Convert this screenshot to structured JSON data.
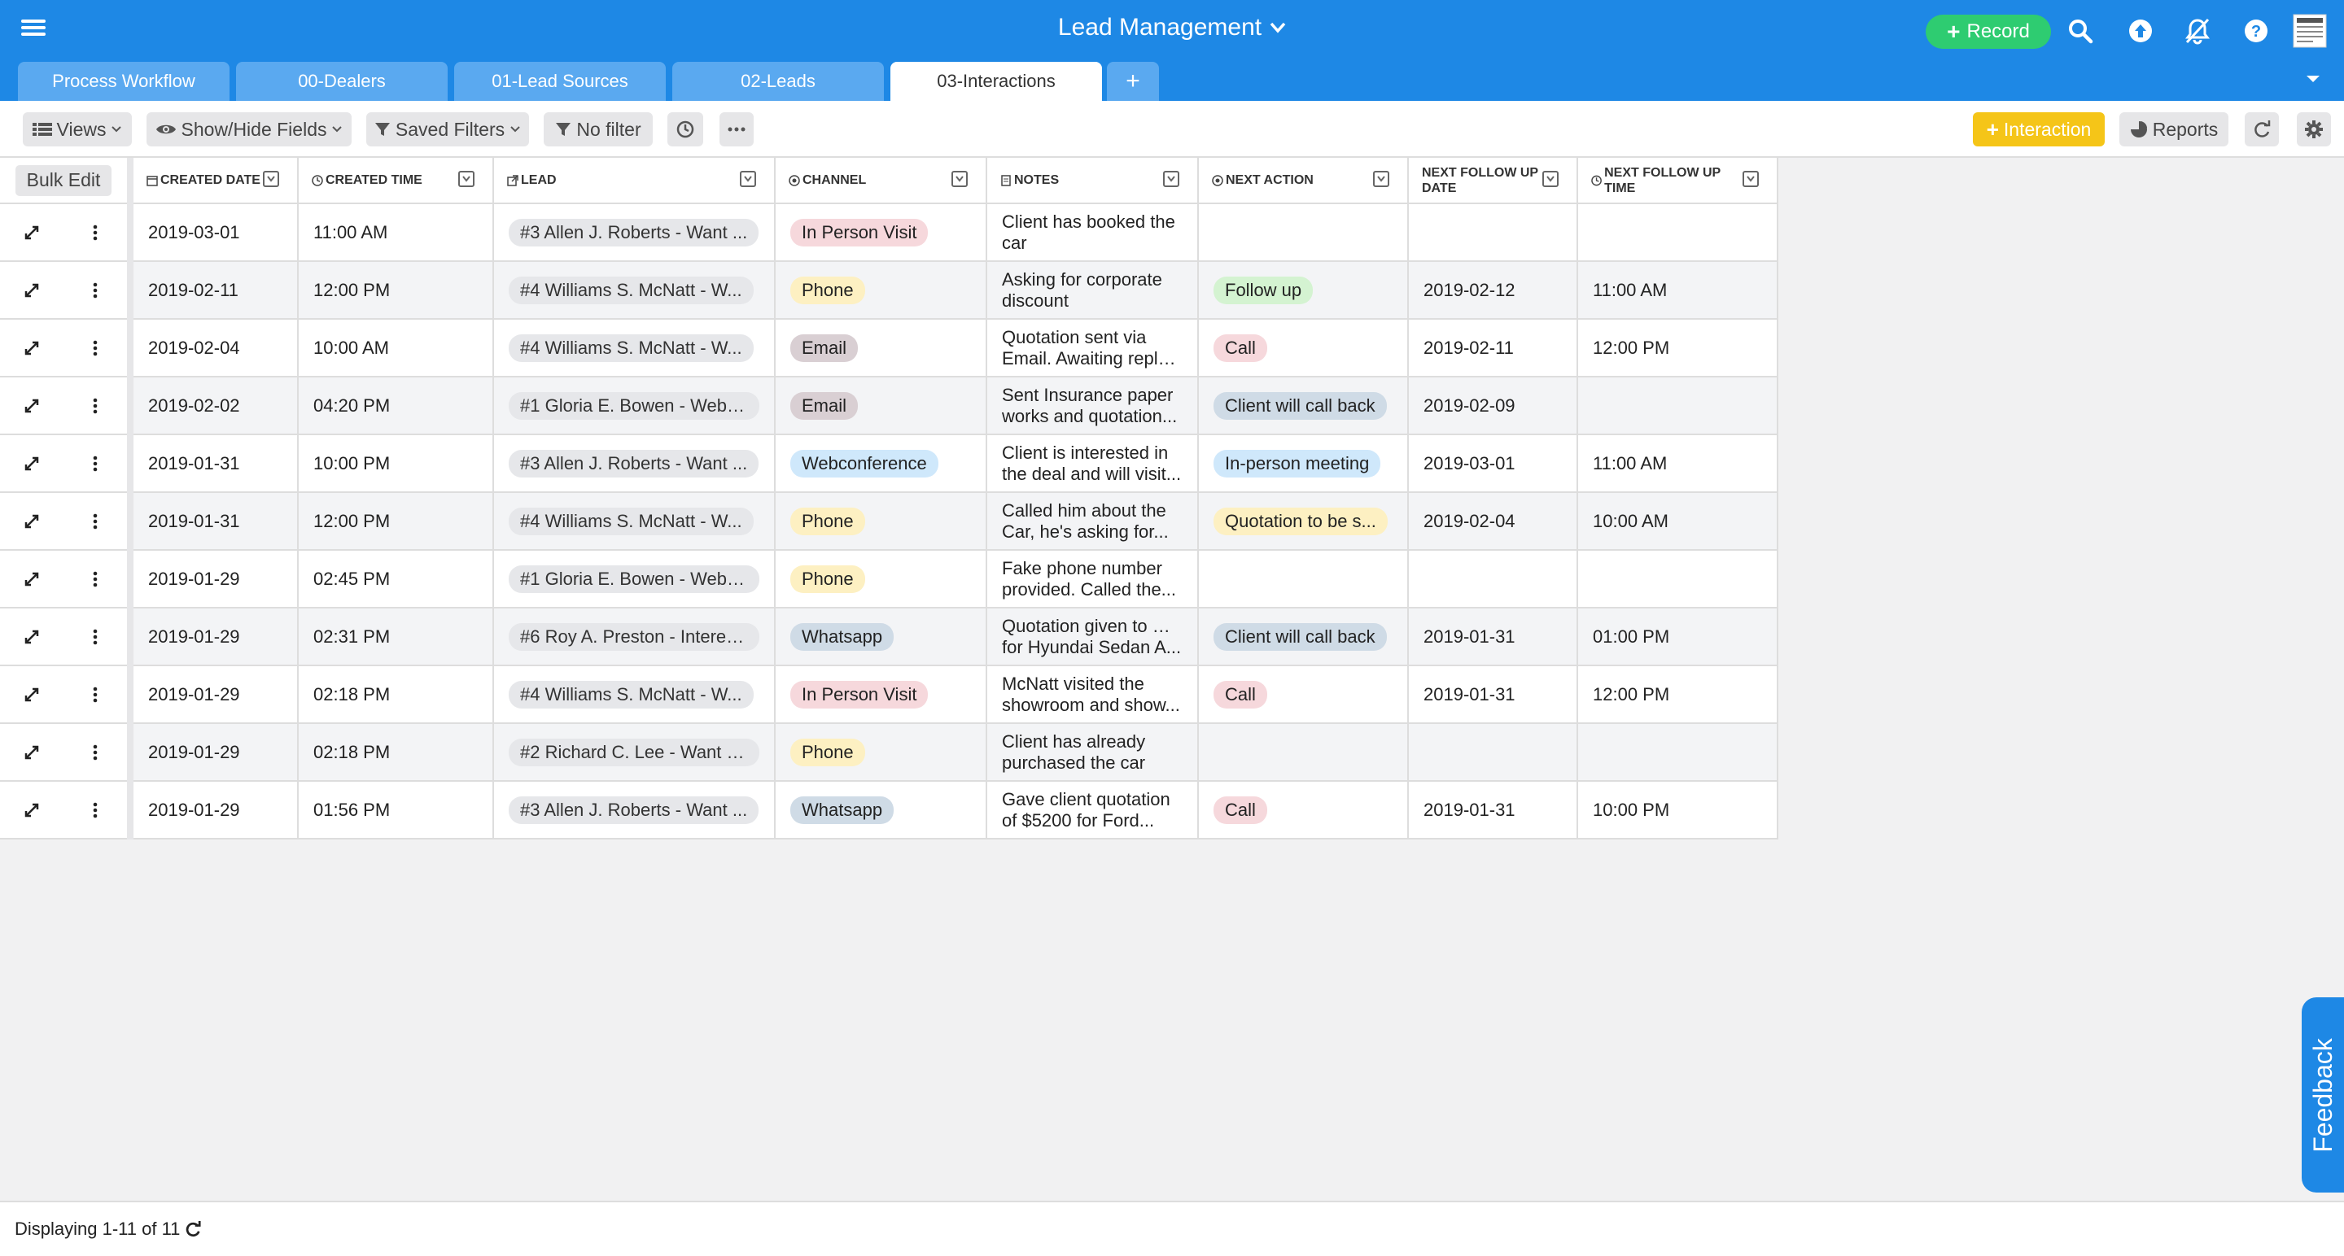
{
  "header": {
    "title": "Lead Management",
    "record_label": "Record"
  },
  "tabs": [
    {
      "label": "Process Workflow",
      "active": false
    },
    {
      "label": "00-Dealers",
      "active": false
    },
    {
      "label": "01-Lead Sources",
      "active": false
    },
    {
      "label": "02-Leads",
      "active": false
    },
    {
      "label": "03-Interactions",
      "active": true
    }
  ],
  "toolbar": {
    "views": "Views",
    "show_hide": "Show/Hide Fields",
    "saved_filters": "Saved Filters",
    "no_filter": "No filter",
    "interaction": "Interaction",
    "reports": "Reports"
  },
  "grid": {
    "bulk_edit": "Bulk Edit",
    "columns": [
      {
        "key": "created_date",
        "label": "CREATED DATE"
      },
      {
        "key": "created_time",
        "label": "CREATED TIME"
      },
      {
        "key": "lead",
        "label": "LEAD"
      },
      {
        "key": "channel",
        "label": "CHANNEL"
      },
      {
        "key": "notes",
        "label": "NOTES"
      },
      {
        "key": "next_action",
        "label": "NEXT ACTION"
      },
      {
        "key": "next_follow_up_date",
        "label": "NEXT FOLLOW UP DATE"
      },
      {
        "key": "next_follow_up_time",
        "label": "NEXT FOLLOW UP TIME"
      }
    ],
    "channel_colors": {
      "In Person Visit": "#f6d8dc",
      "Phone": "#fdf0c2",
      "Email": "#d9cfd3",
      "Webconference": "#cfe8fb",
      "Whatsapp": "#cfdbe6"
    },
    "action_colors": {
      "Follow up": "#d4f3d1",
      "Call": "#f6d8dc",
      "Client will call back": "#cfdbe6",
      "In-person meeting": "#cfe8fb",
      "Quotation to be s...": "#fdf0c2"
    },
    "rows": [
      {
        "created_date": "2019-03-01",
        "created_time": "11:00 AM",
        "lead": "#3 Allen J. Roberts - Want ...",
        "channel": "In Person Visit",
        "notes": [
          "Client has booked the",
          "car"
        ],
        "next_action": "",
        "next_follow_up_date": "",
        "next_follow_up_time": ""
      },
      {
        "created_date": "2019-02-11",
        "created_time": "12:00 PM",
        "lead": "#4 Williams S. McNatt - W...",
        "channel": "Phone",
        "notes": [
          "Asking for corporate",
          "discount"
        ],
        "next_action": "Follow up",
        "next_follow_up_date": "2019-02-12",
        "next_follow_up_time": "11:00 AM"
      },
      {
        "created_date": "2019-02-04",
        "created_time": "10:00 AM",
        "lead": "#4 Williams S. McNatt - W...",
        "channel": "Email",
        "notes": [
          "Quotation sent via",
          "Email. Awaiting reply...."
        ],
        "next_action": "Call",
        "next_follow_up_date": "2019-02-11",
        "next_follow_up_time": "12:00 PM"
      },
      {
        "created_date": "2019-02-02",
        "created_time": "04:20 PM",
        "lead": "#1 Gloria E. Bowen - Web I...",
        "channel": "Email",
        "notes": [
          "Sent Insurance paper",
          "works and quotation..."
        ],
        "next_action": "Client will call back",
        "next_follow_up_date": "2019-02-09",
        "next_follow_up_time": ""
      },
      {
        "created_date": "2019-01-31",
        "created_time": "10:00 PM",
        "lead": "#3 Allen J. Roberts - Want ...",
        "channel": "Webconference",
        "notes": [
          "Client is interested in",
          "the deal and will visit..."
        ],
        "next_action": "In-person meeting",
        "next_follow_up_date": "2019-03-01",
        "next_follow_up_time": "11:00 AM"
      },
      {
        "created_date": "2019-01-31",
        "created_time": "12:00 PM",
        "lead": "#4 Williams S. McNatt - W...",
        "channel": "Phone",
        "notes": [
          "Called him about the",
          "Car, he's asking for..."
        ],
        "next_action": "Quotation to be s...",
        "next_follow_up_date": "2019-02-04",
        "next_follow_up_time": "10:00 AM"
      },
      {
        "created_date": "2019-01-29",
        "created_time": "02:45 PM",
        "lead": "#1 Gloria E. Bowen - Web I...",
        "channel": "Phone",
        "notes": [
          "Fake phone number",
          "provided. Called the..."
        ],
        "next_action": "",
        "next_follow_up_date": "",
        "next_follow_up_time": ""
      },
      {
        "created_date": "2019-01-29",
        "created_time": "02:31 PM",
        "lead": "#6 Roy A. Preston - Interes...",
        "channel": "Whatsapp",
        "notes": [
          "Quotation given to Roy",
          "for Hyundai Sedan A..."
        ],
        "next_action": "Client will call back",
        "next_follow_up_date": "2019-01-31",
        "next_follow_up_time": "01:00 PM"
      },
      {
        "created_date": "2019-01-29",
        "created_time": "02:18 PM",
        "lead": "#4 Williams S. McNatt - W...",
        "channel": "In Person Visit",
        "notes": [
          "McNatt visited the",
          "showroom and show..."
        ],
        "next_action": "Call",
        "next_follow_up_date": "2019-01-31",
        "next_follow_up_time": "12:00 PM"
      },
      {
        "created_date": "2019-01-29",
        "created_time": "02:18 PM",
        "lead": "#2 Richard C. Lee - Want a ...",
        "channel": "Phone",
        "notes": [
          "Client has already",
          "purchased the car"
        ],
        "next_action": "",
        "next_follow_up_date": "",
        "next_follow_up_time": ""
      },
      {
        "created_date": "2019-01-29",
        "created_time": "01:56 PM",
        "lead": "#3 Allen J. Roberts - Want ...",
        "channel": "Whatsapp",
        "notes": [
          "Gave client quotation",
          "of $5200 for Ford..."
        ],
        "next_action": "Call",
        "next_follow_up_date": "2019-01-31",
        "next_follow_up_time": "10:00 PM"
      }
    ]
  },
  "footer": {
    "displaying": "Displaying 1-11 of 11"
  },
  "feedback_label": "Feedback"
}
